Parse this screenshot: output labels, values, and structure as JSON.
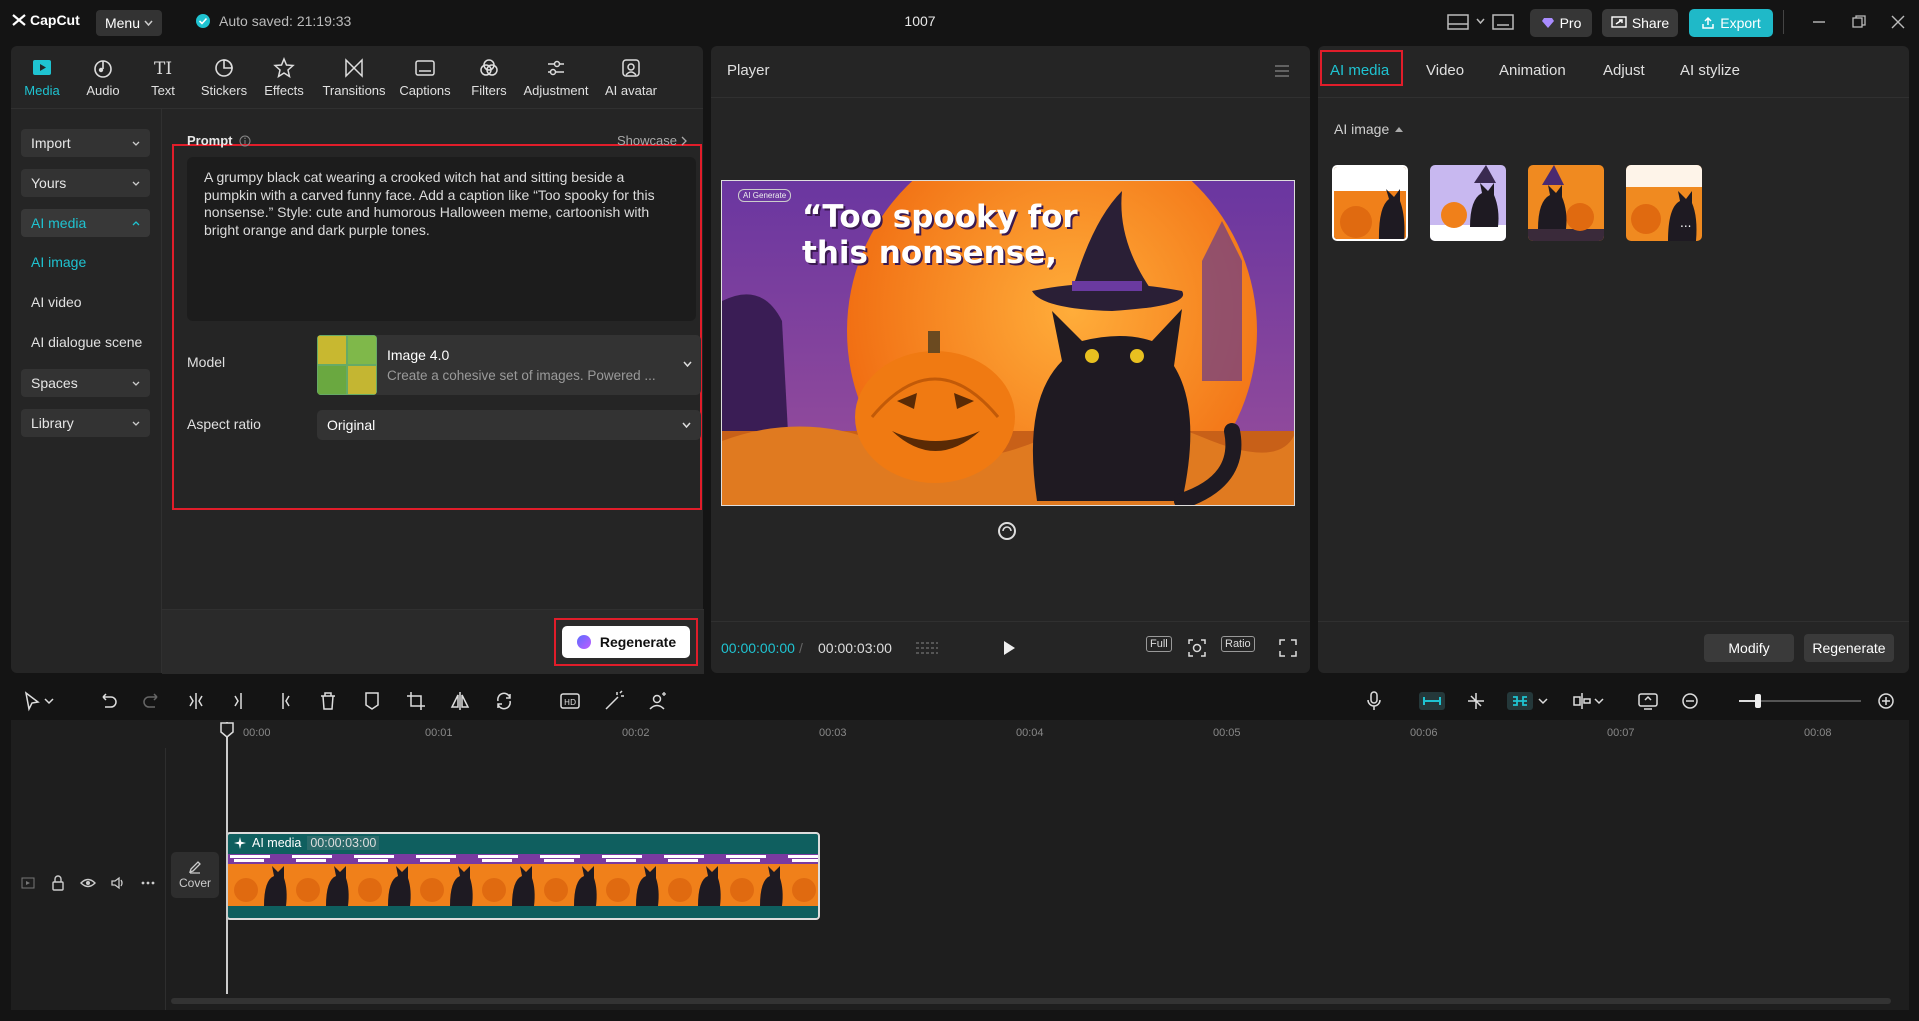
{
  "app": {
    "name": "CapCut",
    "menu_label": "Menu",
    "autosave": "Auto saved: 21:19:33",
    "project_title": "1007"
  },
  "topbar": {
    "pro_label": "Pro",
    "share_label": "Share",
    "export_label": "Export"
  },
  "tool_tabs": [
    "Media",
    "Audio",
    "Text",
    "Stickers",
    "Effects",
    "Transitions",
    "Captions",
    "Filters",
    "Adjustment",
    "AI avatar"
  ],
  "sidenav": {
    "import": "Import",
    "yours": "Yours",
    "ai_media": "AI media",
    "ai_image": "AI image",
    "ai_video": "AI video",
    "ai_dialogue": "AI dialogue scene",
    "spaces": "Spaces",
    "library": "Library"
  },
  "prompt": {
    "label": "Prompt",
    "showcase": "Showcase",
    "text": "A grumpy black cat wearing a crooked witch hat and sitting beside a pumpkin with a carved funny face. Add a caption like “Too spooky for this nonsense.” Style: cute and humorous Halloween meme, cartoonish with bright orange and dark purple tones."
  },
  "model": {
    "label": "Model",
    "name": "Image 4.0",
    "description": "Create a cohesive set of images. Powered ..."
  },
  "aspect": {
    "label": "Aspect ratio",
    "value": "Original"
  },
  "regenerate_label": "Regenerate",
  "player": {
    "title": "Player",
    "caption_line1": "“Too spooky for",
    "caption_line2": "this nonsense,",
    "ai_tag": "AI Generate",
    "timecode_current": "00:00:00:00",
    "timecode_sep": "/",
    "timecode_total": "00:00:03:00",
    "full_label": "Full",
    "ratio_label": "Ratio"
  },
  "right_panel": {
    "tabs": [
      "AI media",
      "Video",
      "Animation",
      "Adjust",
      "AI stylize"
    ],
    "section": "AI image",
    "modify_label": "Modify",
    "regenerate_label": "Regenerate"
  },
  "timeline": {
    "ticks": [
      "00:00",
      "00:01",
      "00:02",
      "00:03",
      "00:04",
      "00:05",
      "00:06",
      "00:07",
      "00:08"
    ],
    "cover_label": "Cover",
    "clip_label": "AI media",
    "clip_duration": "00:00:03:00"
  },
  "colors": {
    "accent": "#1fc3d1",
    "highlight": "#e11d2a",
    "export": "#1fb9c8"
  }
}
